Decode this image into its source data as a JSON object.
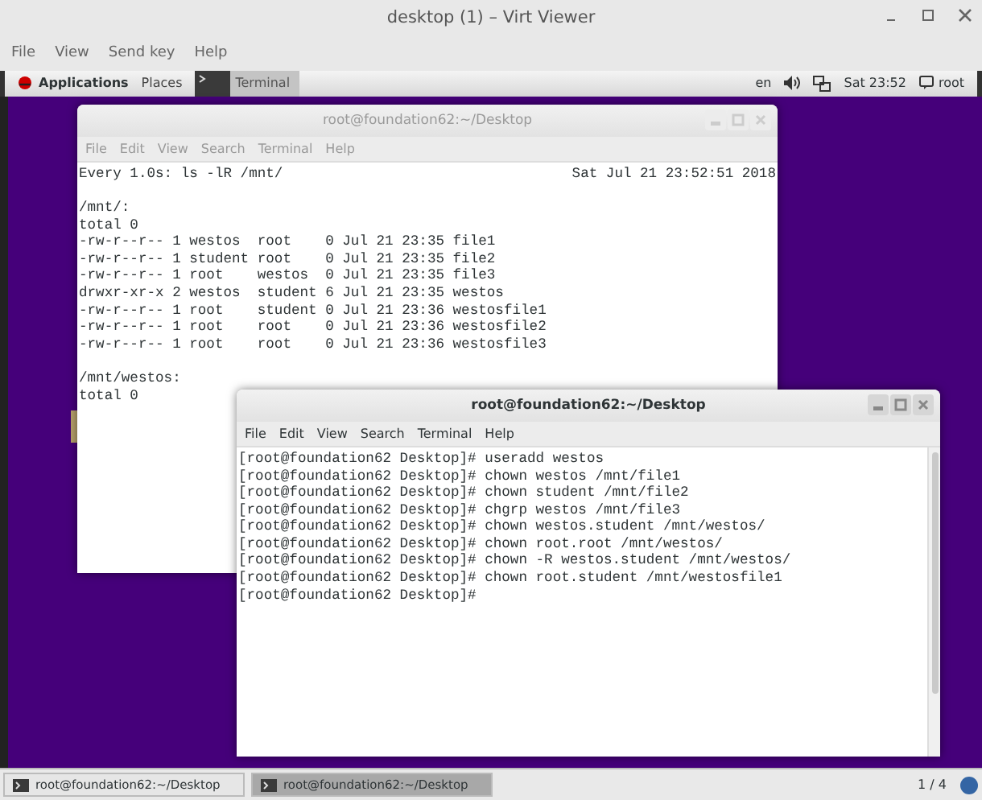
{
  "window": {
    "title": "desktop (1) – Virt Viewer"
  },
  "menu": [
    "File",
    "View",
    "Send key",
    "Help"
  ],
  "top_bar": {
    "applications": "Applications",
    "places": "Places",
    "task": "Terminal",
    "language": "en",
    "clock": "Sat 23:52",
    "user": "root"
  },
  "terminals": [
    {
      "title": "root@foundation62:~/Desktop",
      "active": false,
      "menu": [
        "File",
        "Edit",
        "View",
        "Search",
        "Terminal",
        "Help"
      ],
      "header": {
        "command": "Every 1.0s: ls -lR /mnt/",
        "timestamp": "Sat Jul 21 23:52:51 2018"
      },
      "blocks": [
        [
          "/mnt/:",
          "total 0",
          "-rw-r--r-- 1 westos  root    0 Jul 21 23:35 file1",
          "-rw-r--r-- 1 student root    0 Jul 21 23:35 file2",
          "-rw-r--r-- 1 root    westos  0 Jul 21 23:35 file3",
          "drwxr-xr-x 2 westos  student 6 Jul 21 23:35 westos",
          "-rw-r--r-- 1 root    student 0 Jul 21 23:36 westosfile1",
          "-rw-r--r-- 1 root    root    0 Jul 21 23:36 westosfile2",
          "-rw-r--r-- 1 root    root    0 Jul 21 23:36 westosfile3"
        ],
        [
          "/mnt/westos:",
          "total 0"
        ]
      ]
    },
    {
      "title": "root@foundation62:~/Desktop",
      "active": true,
      "menu": [
        "File",
        "Edit",
        "View",
        "Search",
        "Terminal",
        "Help"
      ],
      "blocks": [
        [
          "[root@foundation62 Desktop]# useradd westos",
          "[root@foundation62 Desktop]# chown westos /mnt/file1",
          "[root@foundation62 Desktop]# chown student /mnt/file2",
          "[root@foundation62 Desktop]# chgrp westos /mnt/file3",
          "[root@foundation62 Desktop]# chown westos.student /mnt/westos/",
          "[root@foundation62 Desktop]# chown root.root /mnt/westos/",
          "[root@foundation62 Desktop]# chown -R westos.student /mnt/westos/",
          "[root@foundation62 Desktop]# chown root.student /mnt/westosfile1",
          "[root@foundation62 Desktop]#"
        ]
      ]
    }
  ],
  "taskbar": {
    "items": [
      {
        "label": "root@foundation62:~/Desktop",
        "selected": false
      },
      {
        "label": "root@foundation62:~/Desktop",
        "selected": true
      }
    ],
    "pager": "1 / 4"
  }
}
